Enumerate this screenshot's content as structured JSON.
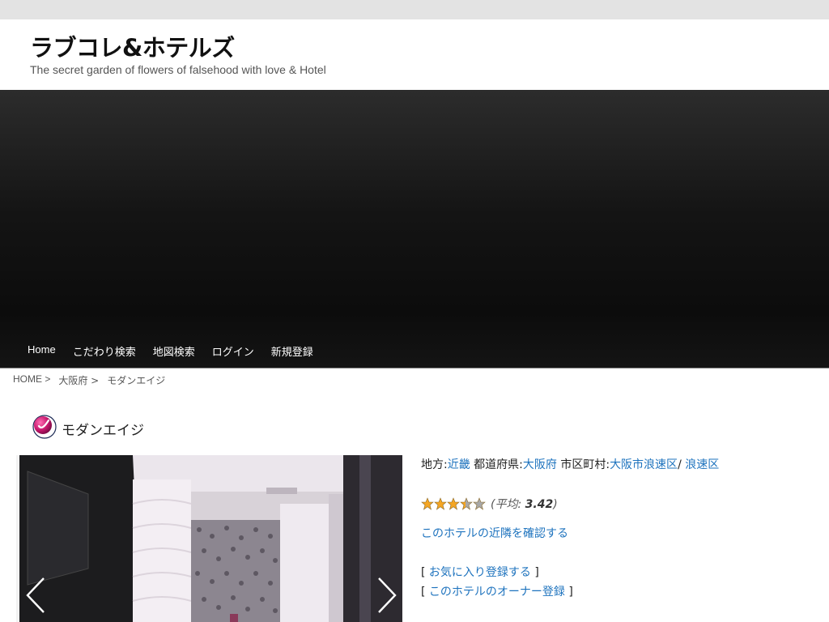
{
  "site": {
    "title": "ラブコレ&ホテルズ",
    "tagline": "The secret garden of flowers of falsehood with love & Hotel"
  },
  "nav": {
    "items": [
      {
        "label": "Home"
      },
      {
        "label": "こだわり検索"
      },
      {
        "label": "地図検索"
      },
      {
        "label": "ログイン"
      },
      {
        "label": "新規登録"
      }
    ]
  },
  "breadcrumb": {
    "home": "HOME >",
    "prefecture": "大阪府 >",
    "current": "モダンエイジ"
  },
  "page": {
    "title": "モダンエイジ"
  },
  "info": {
    "region_label": "地方:",
    "region_value": "近畿",
    "prefecture_label": "都道府県:",
    "prefecture_value": "大阪府",
    "city_label": "市区町村:",
    "city_value": "大阪市浪速区",
    "separator": "/",
    "ward_value": "浪速区",
    "rating_value": 3.42,
    "rating_max": 5,
    "rating_open": "(",
    "rating_avg_label": "平均: ",
    "rating_avg_value": "3.42",
    "rating_close": ")",
    "nearby_link": "このホテルの近隣を確認する",
    "bracket_open": "[",
    "bracket_close": "]",
    "favorite_link": "お気に入り登録する",
    "owner_link": "このホテルのオーナー登録"
  },
  "colors": {
    "link": "#1e73be",
    "header_band": "#e3e3e3",
    "hero": "#141414"
  },
  "icons": {
    "title_icon": "logo-circle-icon",
    "prev": "chevron-left-icon",
    "next": "chevron-right-icon",
    "star": "star-icon"
  }
}
